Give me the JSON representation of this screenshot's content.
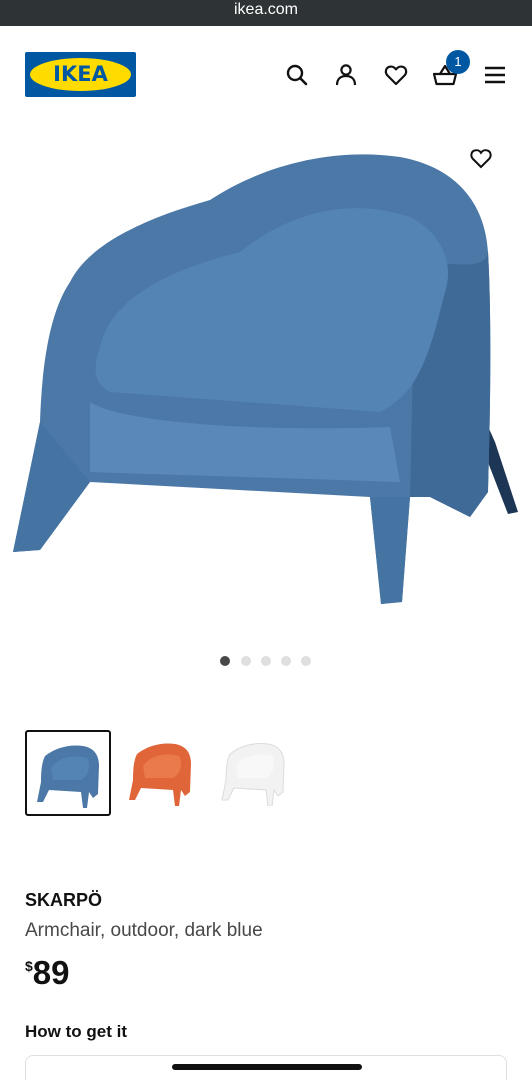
{
  "browser": {
    "url": "ikea.com"
  },
  "header": {
    "logo_text": "IKEA",
    "cart_count": "1",
    "icons": [
      "search-icon",
      "account-icon",
      "heart-icon",
      "basket-icon",
      "menu-icon"
    ]
  },
  "colors": {
    "brand_blue": "#0058a3",
    "brand_yellow": "#ffdb00",
    "chair_blue": "#4a78a8",
    "chair_orange": "#e0663a",
    "chair_white": "#f2f2f2"
  },
  "gallery": {
    "image_count": 5,
    "active_index": 0,
    "variants": [
      "dark blue",
      "orange",
      "white"
    ],
    "selected_variant": 0
  },
  "product": {
    "name": "SKARPÖ",
    "description": "Armchair, outdoor, dark blue",
    "price_currency": "$",
    "price_amount": "89"
  },
  "section": {
    "how_to_get_it": "How to get it"
  }
}
